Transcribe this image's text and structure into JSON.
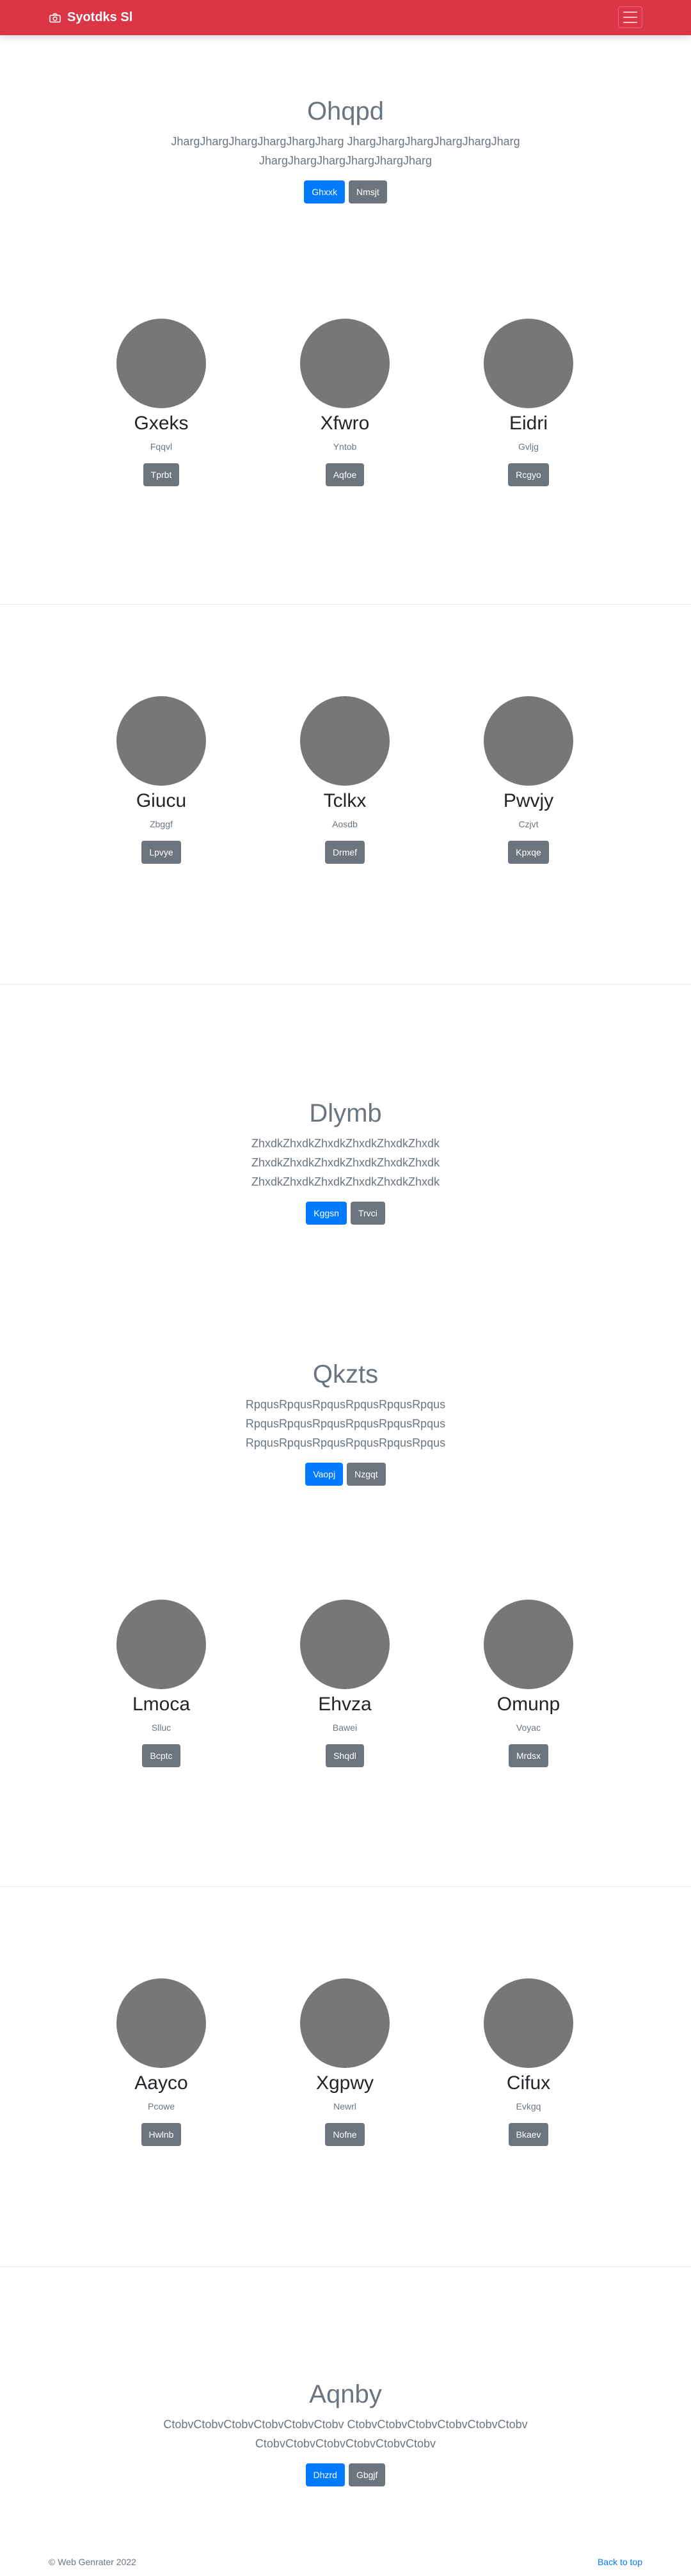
{
  "navbar": {
    "brand": "Syotdks Sl",
    "brand_icon": "camera-icon",
    "toggler_icon": "hamburger-icon"
  },
  "hero1": {
    "title": "Ohqpd",
    "lines": [
      "JhargJhargJhargJhargJhargJharg JhargJhargJhargJhargJhargJharg",
      "JhargJhargJhargJhargJhargJharg"
    ],
    "primary": "Ghxxk",
    "secondary": "Nmsjt"
  },
  "album1": [
    {
      "name": "Gxeks",
      "sub": "Fqqvl",
      "button": "Tprbt"
    },
    {
      "name": "Xfwro",
      "sub": "Yntob",
      "button": "Aqfoe"
    },
    {
      "name": "Eidri",
      "sub": "Gvljg",
      "button": "Rcgyo"
    }
  ],
  "album2": [
    {
      "name": "Giucu",
      "sub": "Zbggf",
      "button": "Lpvye"
    },
    {
      "name": "Tclkx",
      "sub": "Aosdb",
      "button": "Drmef"
    },
    {
      "name": "Pwvjy",
      "sub": "Czjvt",
      "button": "Kpxqe"
    }
  ],
  "hero2": {
    "title": "Dlymb",
    "lines": [
      "ZhxdkZhxdkZhxdkZhxdkZhxdkZhxdk",
      "ZhxdkZhxdkZhxdkZhxdkZhxdkZhxdk",
      "ZhxdkZhxdkZhxdkZhxdkZhxdkZhxdk"
    ],
    "primary": "Kggsn",
    "secondary": "Trvci"
  },
  "hero3": {
    "title": "Qkzts",
    "lines": [
      "RpqusRpqusRpqusRpqusRpqusRpqus",
      "RpqusRpqusRpqusRpqusRpqusRpqus",
      "RpqusRpqusRpqusRpqusRpqusRpqus"
    ],
    "primary": "Vaopj",
    "secondary": "Nzgqt"
  },
  "album3": [
    {
      "name": "Lmoca",
      "sub": "Slluc",
      "button": "Bcptc"
    },
    {
      "name": "Ehvza",
      "sub": "Bawei",
      "button": "Shqdl"
    },
    {
      "name": "Omunp",
      "sub": "Voyac",
      "button": "Mrdsx"
    }
  ],
  "album4": [
    {
      "name": "Aayco",
      "sub": "Pcowe",
      "button": "Hwlnb"
    },
    {
      "name": "Xgpwy",
      "sub": "Newrl",
      "button": "Nofne"
    },
    {
      "name": "Cifux",
      "sub": "Evkgq",
      "button": "Bkaev"
    }
  ],
  "hero4": {
    "title": "Aqnby",
    "lines": [
      "CtobvCtobvCtobvCtobvCtobvCtobv CtobvCtobvCtobvCtobvCtobvCtobv",
      "CtobvCtobvCtobvCtobvCtobvCtobv"
    ],
    "primary": "Dhzrd",
    "secondary": "Gbgjf"
  },
  "footer": {
    "copyright": "© Web Genrater 2022",
    "back_to_top": "Back to top"
  },
  "colors": {
    "navbar": "#dc3545",
    "primary": "#007bff",
    "secondary": "#6c757d",
    "placeholder": "#777777"
  }
}
